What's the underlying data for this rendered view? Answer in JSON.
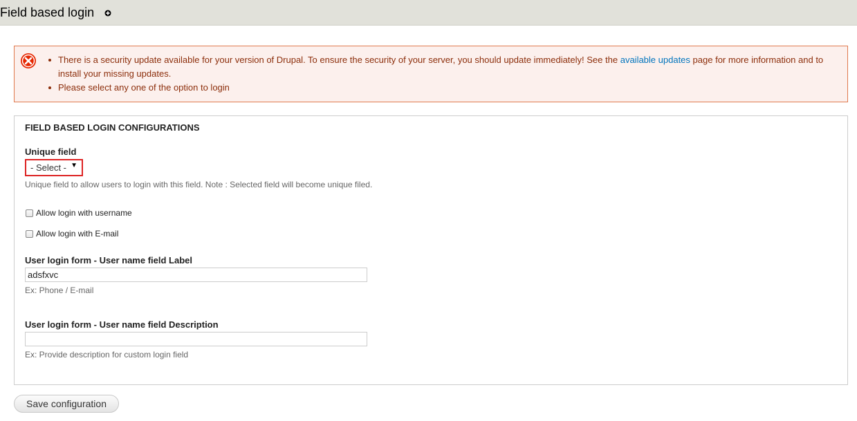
{
  "page": {
    "title": "Field based login"
  },
  "messages": {
    "security_prefix": "There is a security update available for your version of Drupal. To ensure the security of your server, you should update immediately! See the",
    "security_link": "available updates",
    "security_suffix": "page for more information and to install your missing updates.",
    "option_error": "Please select any one of the option to login"
  },
  "form": {
    "legend": "FIELD BASED LOGIN CONFIGURATIONS",
    "unique_field": {
      "label": "Unique field",
      "selected": "- Select -",
      "description": "Unique field to allow users to login with this field. Note : Selected field will become unique filed."
    },
    "allow_username": {
      "label": "Allow login with username",
      "checked": false
    },
    "allow_email": {
      "label": "Allow login with E-mail",
      "checked": false
    },
    "username_label": {
      "label": "User login form - User name field Label",
      "value": "adsfxvc",
      "description": "Ex: Phone / E-mail"
    },
    "username_description": {
      "label": "User login form - User name field Description",
      "value": "",
      "description": "Ex: Provide description for custom login field"
    },
    "save_label": "Save configuration"
  },
  "colors": {
    "error_text": "#8c2e0b",
    "error_border": "#e0784c",
    "error_bg": "#fcf0ed",
    "link": "#0074bd"
  }
}
